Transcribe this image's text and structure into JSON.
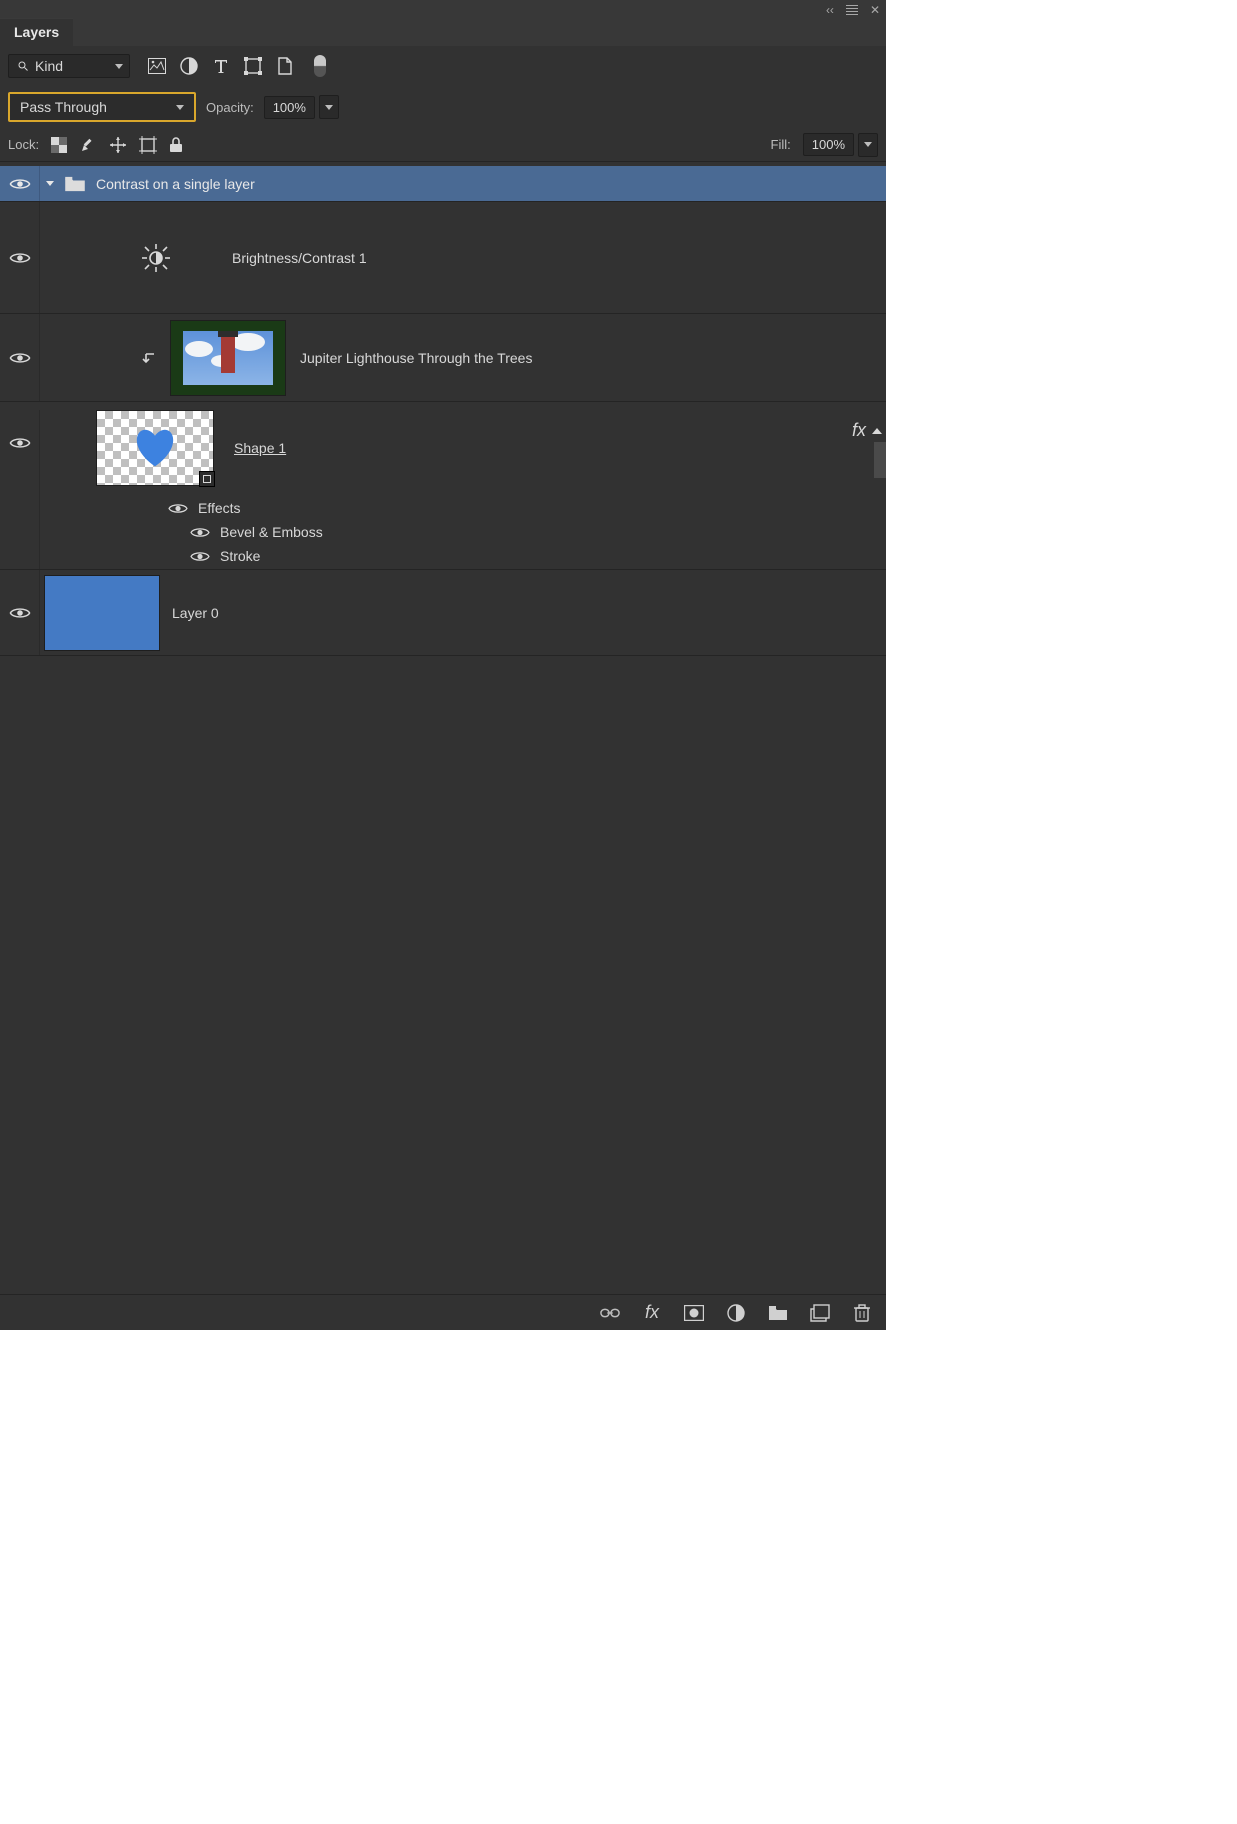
{
  "winbar": {
    "collapse": "‹‹",
    "close": "✕"
  },
  "tabs": {
    "layers": "Layers"
  },
  "filter": {
    "kind_label": "Kind",
    "icons": {
      "image": "image-filter",
      "adjust": "adjustment-filter",
      "type": "type-filter",
      "shape": "shape-filter",
      "smart": "smart-filter"
    }
  },
  "blend": {
    "mode": "Pass Through",
    "opacity_label": "Opacity:",
    "opacity_value": "100%"
  },
  "lock": {
    "label": "Lock:",
    "fill_label": "Fill:",
    "fill_value": "100%"
  },
  "layers": {
    "group_name": "Contrast on a single layer",
    "adjustment_name": "Brightness/Contrast 1",
    "clipped_name": "Jupiter Lighthouse Through the Trees",
    "shape_name": " Shape 1 ",
    "effects_label": "Effects",
    "effect_bevel": "Bevel & Emboss",
    "effect_stroke": "Stroke",
    "layer0_name": "Layer 0",
    "fx_label": "fx"
  },
  "bottom": {
    "link": "link-layers",
    "fx": "fx",
    "mask": "add-mask",
    "adjust": "new-adjustment",
    "group": "new-group",
    "new": "new-layer",
    "trash": "delete-layer"
  }
}
